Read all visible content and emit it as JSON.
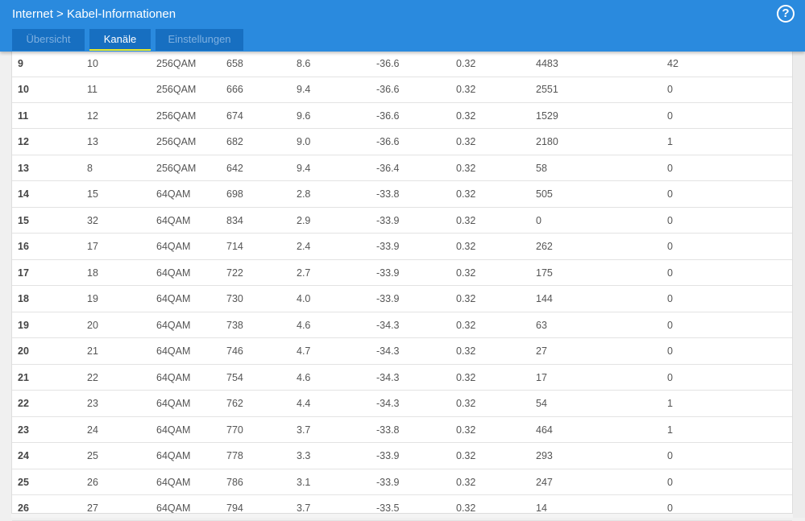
{
  "header": {
    "breadcrumb_root": "Internet",
    "breadcrumb_sep": ">",
    "breadcrumb_page": "Kabel-Informationen",
    "help": "?"
  },
  "tabs": [
    {
      "label": "Übersicht",
      "active": false
    },
    {
      "label": "Kanäle",
      "active": true
    },
    {
      "label": "Einstellungen",
      "active": false
    }
  ],
  "rows": [
    [
      "9",
      "10",
      "256QAM",
      "658",
      "8.6",
      "-36.6",
      "0.32",
      "4483",
      "42"
    ],
    [
      "10",
      "11",
      "256QAM",
      "666",
      "9.4",
      "-36.6",
      "0.32",
      "2551",
      "0"
    ],
    [
      "11",
      "12",
      "256QAM",
      "674",
      "9.6",
      "-36.6",
      "0.32",
      "1529",
      "0"
    ],
    [
      "12",
      "13",
      "256QAM",
      "682",
      "9.0",
      "-36.6",
      "0.32",
      "2180",
      "1"
    ],
    [
      "13",
      "8",
      "256QAM",
      "642",
      "9.4",
      "-36.4",
      "0.32",
      "58",
      "0"
    ],
    [
      "14",
      "15",
      "64QAM",
      "698",
      "2.8",
      "-33.8",
      "0.32",
      "505",
      "0"
    ],
    [
      "15",
      "32",
      "64QAM",
      "834",
      "2.9",
      "-33.9",
      "0.32",
      "0",
      "0"
    ],
    [
      "16",
      "17",
      "64QAM",
      "714",
      "2.4",
      "-33.9",
      "0.32",
      "262",
      "0"
    ],
    [
      "17",
      "18",
      "64QAM",
      "722",
      "2.7",
      "-33.9",
      "0.32",
      "175",
      "0"
    ],
    [
      "18",
      "19",
      "64QAM",
      "730",
      "4.0",
      "-33.9",
      "0.32",
      "144",
      "0"
    ],
    [
      "19",
      "20",
      "64QAM",
      "738",
      "4.6",
      "-34.3",
      "0.32",
      "63",
      "0"
    ],
    [
      "20",
      "21",
      "64QAM",
      "746",
      "4.7",
      "-34.3",
      "0.32",
      "27",
      "0"
    ],
    [
      "21",
      "22",
      "64QAM",
      "754",
      "4.6",
      "-34.3",
      "0.32",
      "17",
      "0"
    ],
    [
      "22",
      "23",
      "64QAM",
      "762",
      "4.4",
      "-34.3",
      "0.32",
      "54",
      "1"
    ],
    [
      "23",
      "24",
      "64QAM",
      "770",
      "3.7",
      "-33.8",
      "0.32",
      "464",
      "1"
    ],
    [
      "24",
      "25",
      "64QAM",
      "778",
      "3.3",
      "-33.9",
      "0.32",
      "293",
      "0"
    ],
    [
      "25",
      "26",
      "64QAM",
      "786",
      "3.1",
      "-33.9",
      "0.32",
      "247",
      "0"
    ],
    [
      "26",
      "27",
      "64QAM",
      "794",
      "3.7",
      "-33.5",
      "0.32",
      "14",
      "0"
    ]
  ]
}
